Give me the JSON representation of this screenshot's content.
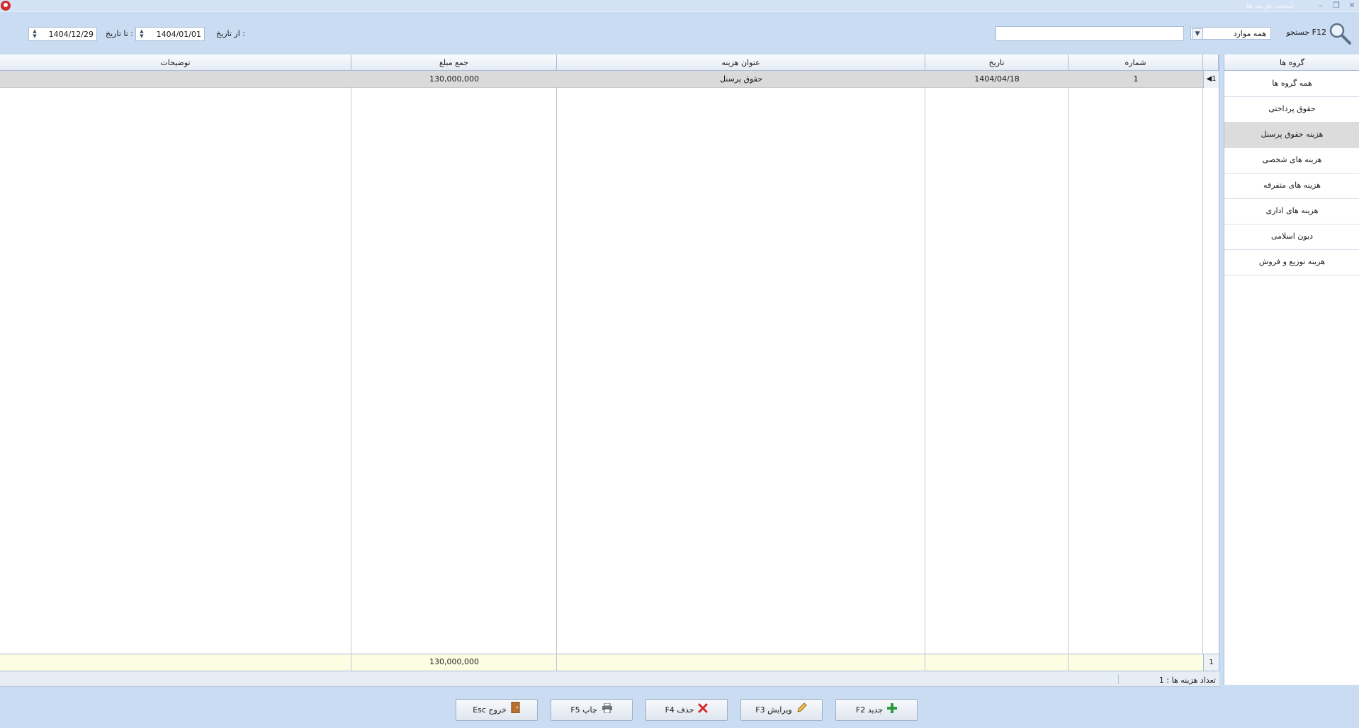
{
  "window": {
    "title": "لیست هزینه ها"
  },
  "toolbar": {
    "search_label": "جستجو F12",
    "filter_value": "همه موارد",
    "search_placeholder": "",
    "from_label": "از تاریخ :",
    "from_date": "1404/01/01",
    "to_label": "تا تاریخ :",
    "to_date": "1404/12/29"
  },
  "groups": {
    "header": "گروه ها",
    "items": [
      "همه گروه ها",
      "حقوق پرداختی",
      "هزینه حقوق پرسنل",
      "هزینه های شخصی",
      "هزینه های متفرقه",
      "هزینه های اداری",
      "دیون اسلامی",
      "هزینه توزیع و فروش"
    ],
    "selected_index": 2
  },
  "grid": {
    "columns": [
      "شماره",
      "تاریخ",
      "عنوان هزینه",
      "جمع مبلغ",
      "توضیحات"
    ],
    "rows": [
      {
        "index": "1",
        "number": "1",
        "date": "1404/04/18",
        "title": "حقوق پرسنل",
        "amount": "130,000,000",
        "description": ""
      }
    ],
    "footer": {
      "count": "1",
      "total": "130,000,000"
    }
  },
  "status": {
    "text": "تعداد هزینه ها : 1"
  },
  "buttons": {
    "new": "جدید F2",
    "edit": "ویرایش F3",
    "delete": "حذف F4",
    "print": "چاپ F5",
    "exit": "خروج Esc"
  },
  "colors": {
    "background": "#c9dcf2",
    "selected_row": "#dadada",
    "footer": "#fdfde3"
  }
}
